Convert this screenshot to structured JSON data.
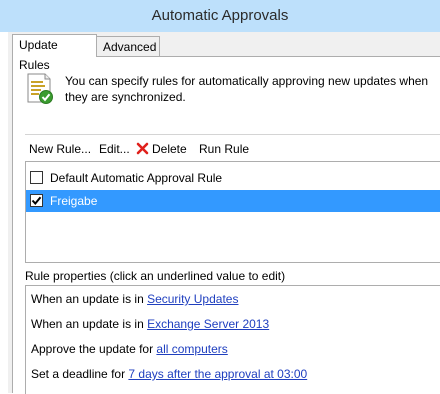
{
  "window": {
    "title": "Automatic Approvals"
  },
  "tabs": [
    {
      "label": "Update Rules",
      "active": true
    },
    {
      "label": "Advanced",
      "active": false
    }
  ],
  "info": {
    "icon": "rules-document-icon",
    "text": "You can specify rules for automatically approving new updates when they are synchronized."
  },
  "toolbar": {
    "new_rule": "New Rule...",
    "edit": "Edit...",
    "delete": "Delete",
    "run_rule": "Run Rule"
  },
  "rules": [
    {
      "label": "Default Automatic Approval Rule",
      "checked": false,
      "selected": false
    },
    {
      "label": "Freigabe",
      "checked": true,
      "selected": true
    }
  ],
  "properties": {
    "title": "Rule properties (click an underlined value to edit)",
    "lines": [
      {
        "prefix": "When an update is in ",
        "link": "Security Updates"
      },
      {
        "prefix": "When an update is in ",
        "link": "Exchange Server 2013"
      },
      {
        "prefix": "Approve the update for ",
        "link": "all computers"
      },
      {
        "prefix": "Set a deadline for ",
        "link": "7 days after the approval at 03:00"
      }
    ]
  },
  "colors": {
    "titlebar": "#bde0fb",
    "selection": "#3399ff",
    "link": "#1f3fbf",
    "delete_icon": "#e0201b"
  }
}
